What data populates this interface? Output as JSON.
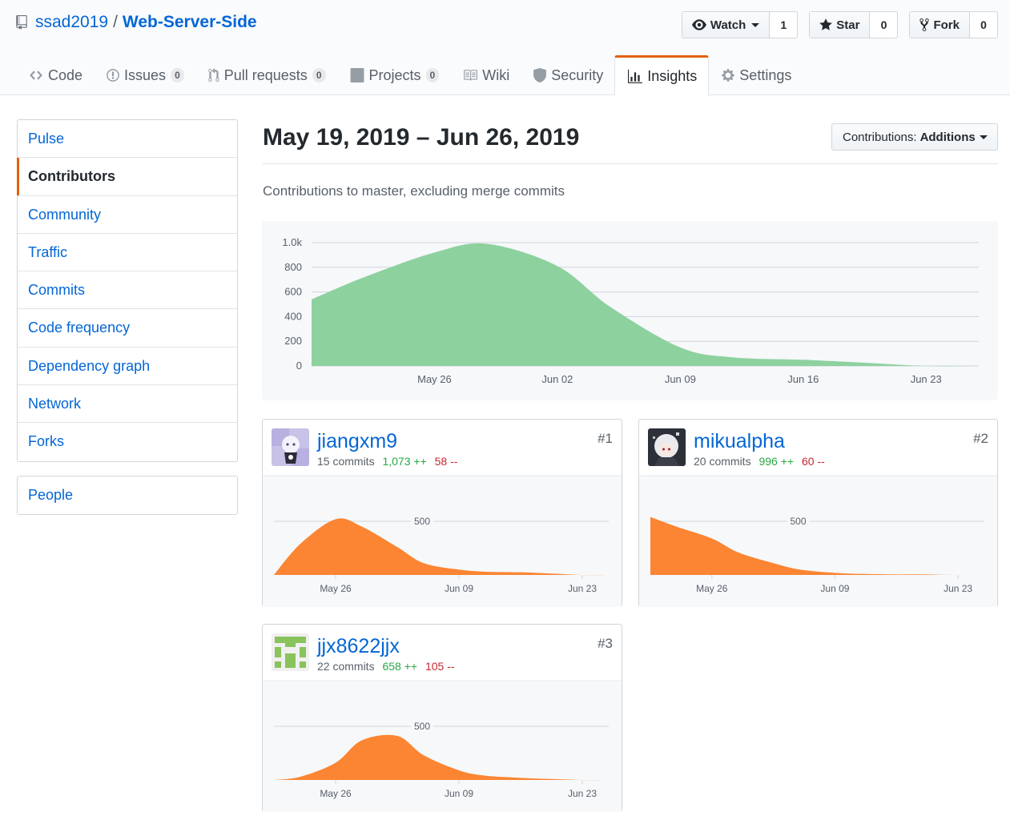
{
  "repo": {
    "owner": "ssad2019",
    "name": "Web-Server-Side"
  },
  "actions": {
    "watch": {
      "label": "Watch",
      "count": "1"
    },
    "star": {
      "label": "Star",
      "count": "0"
    },
    "fork": {
      "label": "Fork",
      "count": "0"
    }
  },
  "tabs": [
    {
      "label": "Code",
      "icon": "code-icon"
    },
    {
      "label": "Issues",
      "count": "0",
      "icon": "issue-icon"
    },
    {
      "label": "Pull requests",
      "count": "0",
      "icon": "pull-request-icon"
    },
    {
      "label": "Projects",
      "count": "0",
      "icon": "project-icon"
    },
    {
      "label": "Wiki",
      "icon": "book-icon"
    },
    {
      "label": "Security",
      "icon": "shield-icon"
    },
    {
      "label": "Insights",
      "icon": "graph-icon",
      "selected": true
    },
    {
      "label": "Settings",
      "icon": "gear-icon"
    }
  ],
  "sidebar": {
    "items": [
      {
        "label": "Pulse"
      },
      {
        "label": "Contributors",
        "selected": true
      },
      {
        "label": "Community"
      },
      {
        "label": "Traffic"
      },
      {
        "label": "Commits"
      },
      {
        "label": "Code frequency"
      },
      {
        "label": "Dependency graph"
      },
      {
        "label": "Network"
      },
      {
        "label": "Forks"
      }
    ],
    "people": "People"
  },
  "main": {
    "date_range": "May 19, 2019 – Jun 26, 2019",
    "select_prefix": "Contributions:",
    "select_value": "Additions",
    "subtitle": "Contributions to master, excluding merge commits"
  },
  "colors": {
    "accent": "#e36209",
    "link": "#0366d6",
    "main_area": "#8dd19f",
    "contrib_area": "#fb8532",
    "add": "#28a745",
    "del": "#cb2431"
  },
  "chart_data": [
    {
      "type": "area",
      "title": "",
      "x": [
        "May 19",
        "May 22",
        "May 26",
        "May 29",
        "Jun 02",
        "Jun 05",
        "Jun 09",
        "Jun 12",
        "Jun 16",
        "Jun 19",
        "Jun 23",
        "Jun 26"
      ],
      "values": [
        540,
        720,
        920,
        990,
        810,
        480,
        150,
        70,
        50,
        30,
        0,
        0
      ],
      "x_ticks": [
        "May 26",
        "Jun 02",
        "Jun 09",
        "Jun 16",
        "Jun 23"
      ],
      "y_ticks": [
        "1.0k",
        "800",
        "600",
        "400",
        "200",
        "0"
      ],
      "ylim": [
        0,
        1000
      ],
      "grid": true
    },
    {
      "type": "area",
      "contributor": "jiangxm9",
      "x": [
        "May 19",
        "May 22",
        "May 26",
        "May 29",
        "Jun 02",
        "Jun 05",
        "Jun 09",
        "Jun 12",
        "Jun 16",
        "Jun 19",
        "Jun 23",
        "Jun 26"
      ],
      "values": [
        0,
        290,
        520,
        450,
        260,
        110,
        50,
        30,
        25,
        15,
        0,
        0
      ],
      "x_ticks": [
        "May 26",
        "Jun 09",
        "Jun 23"
      ],
      "y_ticks": [
        "500"
      ],
      "ylim": [
        0,
        500
      ]
    },
    {
      "type": "area",
      "contributor": "mikualpha",
      "x": [
        "May 19",
        "May 22",
        "May 26",
        "May 29",
        "Jun 02",
        "Jun 05",
        "Jun 09",
        "Jun 12",
        "Jun 16",
        "Jun 19",
        "Jun 23",
        "Jun 26"
      ],
      "values": [
        540,
        450,
        340,
        210,
        110,
        50,
        20,
        10,
        5,
        5,
        0,
        0
      ],
      "x_ticks": [
        "May 26",
        "Jun 09",
        "Jun 23"
      ],
      "y_ticks": [
        "500"
      ],
      "ylim": [
        0,
        500
      ]
    },
    {
      "type": "area",
      "contributor": "jjx8622jjx",
      "x": [
        "May 19",
        "May 22",
        "May 26",
        "May 29",
        "Jun 02",
        "Jun 05",
        "Jun 09",
        "Jun 12",
        "Jun 16",
        "Jun 19",
        "Jun 23",
        "Jun 26"
      ],
      "values": [
        0,
        30,
        160,
        370,
        410,
        230,
        90,
        40,
        20,
        10,
        0,
        0
      ],
      "x_ticks": [
        "May 26",
        "Jun 09",
        "Jun 23"
      ],
      "y_ticks": [
        "500"
      ],
      "ylim": [
        0,
        500
      ]
    }
  ],
  "contributors": [
    {
      "login": "jiangxm9",
      "commits": "15 commits",
      "additions": "1,073 ++",
      "deletions": "58 --",
      "rank": "#1"
    },
    {
      "login": "mikualpha",
      "commits": "20 commits",
      "additions": "996 ++",
      "deletions": "60 --",
      "rank": "#2"
    },
    {
      "login": "jjx8622jjx",
      "commits": "22 commits",
      "additions": "658 ++",
      "deletions": "105 --",
      "rank": "#3"
    }
  ]
}
